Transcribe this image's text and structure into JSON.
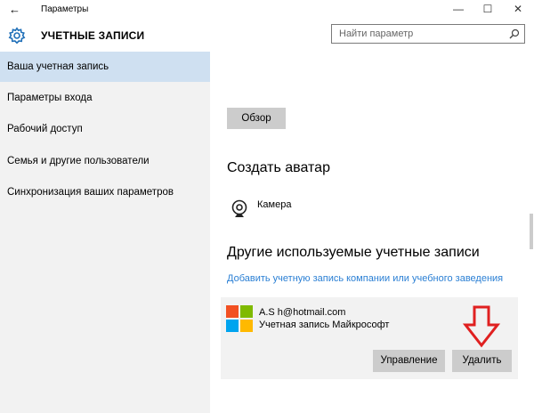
{
  "window": {
    "title": "Параметры",
    "back_icon": "back-arrow-icon",
    "controls": [
      "minimize-icon",
      "maximize-icon",
      "close-icon"
    ]
  },
  "header": {
    "section_title": "УЧЕТНЫЕ ЗАПИСИ",
    "icon": "gear-icon"
  },
  "search": {
    "placeholder": "Найти параметр",
    "icon": "search-icon"
  },
  "sidebar": {
    "items": [
      {
        "label": "Ваша учетная запись",
        "active": true
      },
      {
        "label": "Параметры входа",
        "active": false
      },
      {
        "label": "Рабочий доступ",
        "active": false
      },
      {
        "label": "Семья и другие пользователи",
        "active": false
      },
      {
        "label": "Синхронизация ваших параметров",
        "active": false
      }
    ]
  },
  "main": {
    "browse_button": "Обзор",
    "create_avatar_heading": "Создать аватар",
    "camera_label": "Камера",
    "other_accounts_heading": "Другие используемые учетные записи",
    "add_account_link": "Добавить учетную запись компании или учебного заведения",
    "account": {
      "email": "A.S          h@hotmail.com",
      "type": "Учетная запись Майкрософт",
      "manage_button": "Управление",
      "delete_button": "Удалить"
    }
  },
  "colors": {
    "sidebar_bg": "#f2f2f2",
    "active_item_bg": "#cfe0f1",
    "link": "#2a7fd4",
    "button_bg": "#cccccc",
    "annotation_arrow": "#e02020"
  }
}
